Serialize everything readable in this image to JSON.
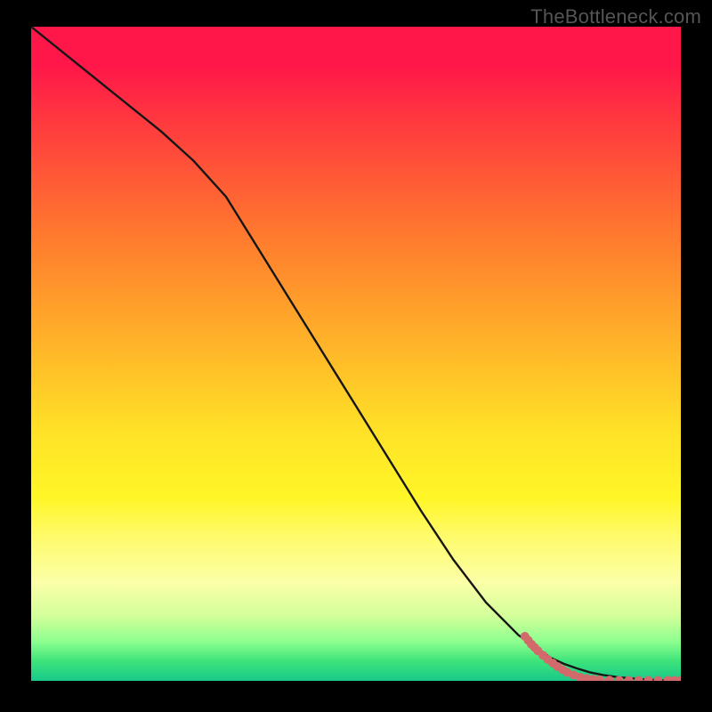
{
  "watermark": "TheBottleneck.com",
  "colors": {
    "gradient_top": "#ff1749",
    "gradient_mid": "#ffe227",
    "gradient_bottom": "#18c98a",
    "curve": "#161616",
    "dots": "#d26a6b",
    "frame": "#000000"
  },
  "chart_data": {
    "type": "line",
    "title": "",
    "xlabel": "",
    "ylabel": "",
    "xlim": [
      0,
      100
    ],
    "ylim": [
      0,
      100
    ],
    "grid": false,
    "series": [
      {
        "name": "curve",
        "x": [
          0,
          5,
          10,
          15,
          20,
          25,
          30,
          35,
          40,
          45,
          50,
          55,
          60,
          65,
          70,
          75,
          80,
          82,
          84,
          86,
          88,
          90,
          92,
          94,
          96,
          98,
          100
        ],
        "y": [
          100,
          96,
          92,
          88,
          84,
          79.5,
          74,
          66,
          58,
          50,
          42,
          34,
          26,
          18.5,
          12,
          7,
          3.5,
          2.6,
          1.9,
          1.3,
          0.9,
          0.6,
          0.4,
          0.25,
          0.15,
          0.08,
          0.05
        ]
      }
    ],
    "scatter": {
      "name": "highlighted_points",
      "points": [
        {
          "x": 76.0,
          "y": 6.8
        },
        {
          "x": 76.5,
          "y": 6.2
        },
        {
          "x": 77.0,
          "y": 5.6
        },
        {
          "x": 77.5,
          "y": 5.1
        },
        {
          "x": 78.0,
          "y": 4.6
        },
        {
          "x": 78.8,
          "y": 3.9
        },
        {
          "x": 79.5,
          "y": 3.3
        },
        {
          "x": 80.3,
          "y": 2.7
        },
        {
          "x": 81.0,
          "y": 2.2
        },
        {
          "x": 81.8,
          "y": 1.7
        },
        {
          "x": 82.5,
          "y": 1.3
        },
        {
          "x": 83.5,
          "y": 0.9
        },
        {
          "x": 84.5,
          "y": 0.55
        },
        {
          "x": 85.5,
          "y": 0.35
        },
        {
          "x": 86.5,
          "y": 0.22
        },
        {
          "x": 87.5,
          "y": 0.15
        },
        {
          "x": 89.0,
          "y": 0.1
        },
        {
          "x": 90.5,
          "y": 0.08
        },
        {
          "x": 92.0,
          "y": 0.07
        },
        {
          "x": 93.5,
          "y": 0.06
        },
        {
          "x": 95.0,
          "y": 0.06
        },
        {
          "x": 96.5,
          "y": 0.06
        },
        {
          "x": 98.0,
          "y": 0.06
        },
        {
          "x": 99.0,
          "y": 0.06
        },
        {
          "x": 100.0,
          "y": 0.06
        }
      ]
    }
  }
}
